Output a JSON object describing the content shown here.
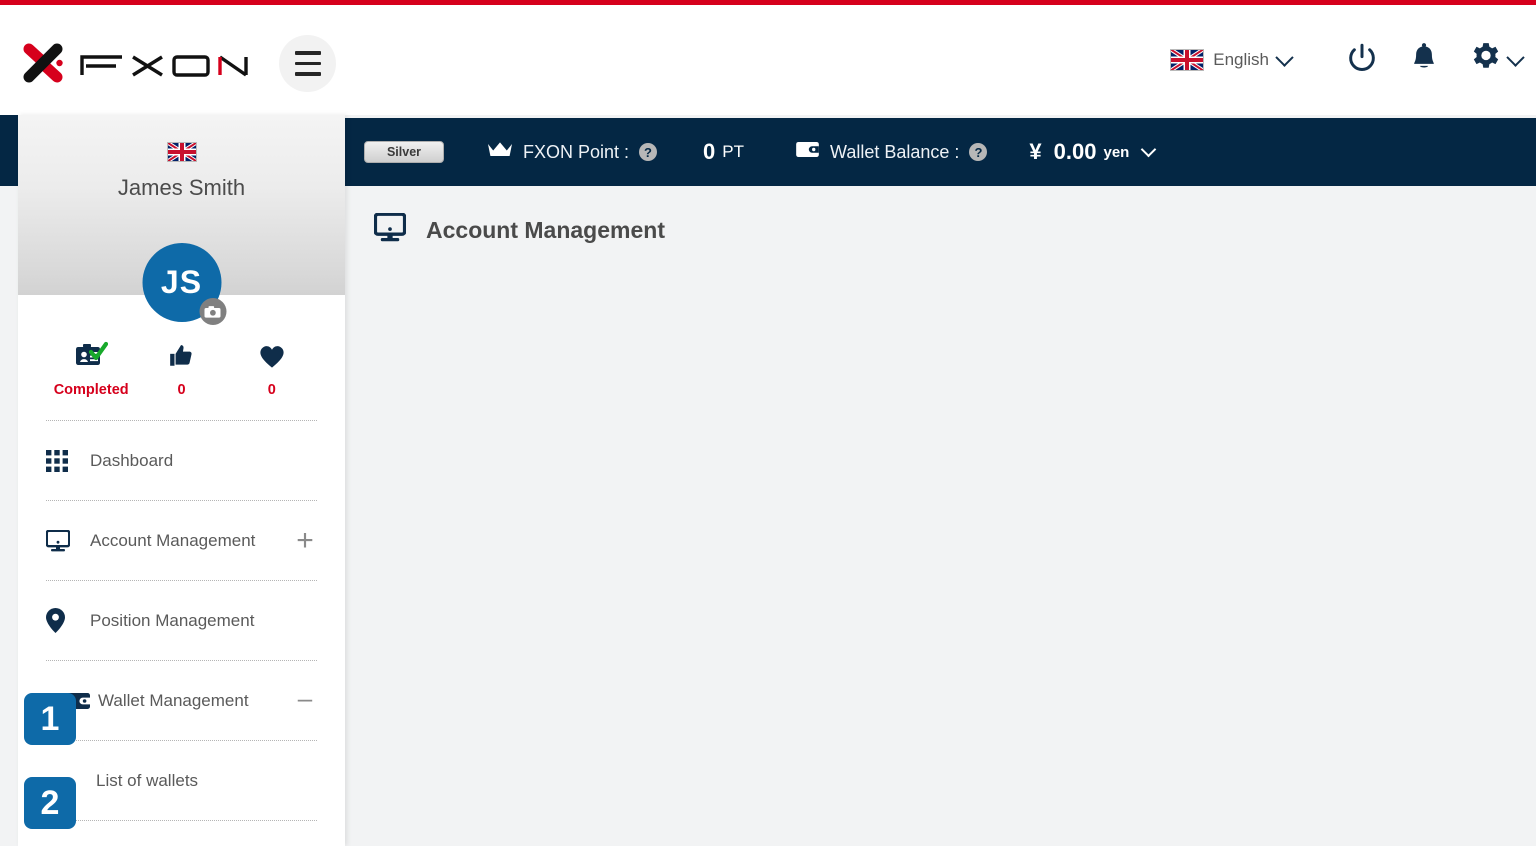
{
  "brand": {
    "logo_text": "FXON",
    "accent_red": "#d6001c",
    "navy": "#042744",
    "blue": "#0e6aa8"
  },
  "header": {
    "menu_icon": "hamburger-icon",
    "language": {
      "flag": "uk-flag-icon",
      "label": "English",
      "chevron": "chevron-down-icon"
    },
    "power_icon": "power-icon",
    "notifications_icon": "bell-icon",
    "settings_icon": "gear-icon",
    "settings_chevron": "chevron-down-icon"
  },
  "sidebar": {
    "profile": {
      "flag": "uk-flag-icon",
      "name": "James Smith",
      "avatar_initials": "JS",
      "avatar_camera_icon": "camera-icon"
    },
    "stats": [
      {
        "icon": "id-verified-icon",
        "label": "Completed"
      },
      {
        "icon": "thumbs-up-icon",
        "label": "0"
      },
      {
        "icon": "heart-icon",
        "label": "0"
      }
    ],
    "nav": [
      {
        "icon": "grid-icon",
        "label": "Dashboard",
        "expander": ""
      },
      {
        "icon": "monitor-icon",
        "label": "Account Management",
        "expander": "+"
      },
      {
        "icon": "pin-icon",
        "label": "Position Management",
        "expander": ""
      },
      {
        "icon": "wallet-icon",
        "label": "Wallet Management",
        "expander": "–"
      },
      {
        "icon": "",
        "label": "List of wallets",
        "expander": ""
      }
    ],
    "step_badges": [
      {
        "number": "1"
      },
      {
        "number": "2"
      }
    ]
  },
  "infobar": {
    "tier": "Silver",
    "point": {
      "icon": "crown-icon",
      "label": "FXON Point :",
      "help": "?",
      "value": "0",
      "unit": "PT"
    },
    "wallet": {
      "icon": "wallet-icon",
      "label": "Wallet Balance :",
      "help": "?",
      "currency_symbol": "¥",
      "value": "0.00",
      "unit": "yen",
      "chevron": "chevron-down-icon"
    }
  },
  "main": {
    "page_icon": "monitor-icon",
    "page_title": "Account Management"
  }
}
